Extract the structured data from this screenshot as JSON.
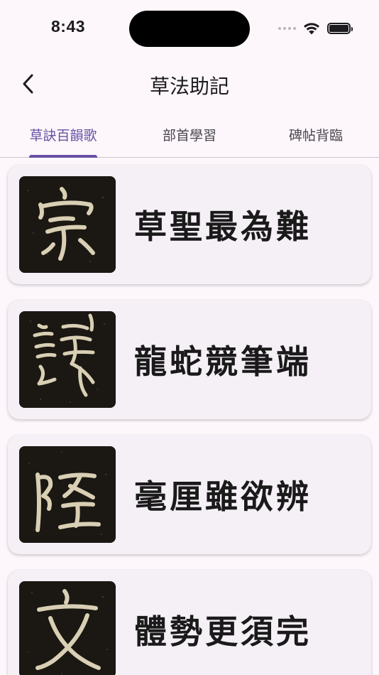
{
  "status_bar": {
    "time": "8:43"
  },
  "header": {
    "title": "草法助記",
    "back_icon": "chevron-left-icon"
  },
  "tabs": [
    {
      "label": "草訣百韻歌",
      "active": true
    },
    {
      "label": "部首學習",
      "active": false
    },
    {
      "label": "碑帖背臨",
      "active": false
    }
  ],
  "items": [
    {
      "text": "草聖最為難",
      "image_glyph": "宗"
    },
    {
      "text": "龍蛇競筆端",
      "image_glyph": "読"
    },
    {
      "text": "毫厘雖欲辨",
      "image_glyph": "陸"
    },
    {
      "text": "體勢更須完",
      "image_glyph": "文"
    }
  ],
  "colors": {
    "background": "#fdf7fb",
    "card": "#f5eff6",
    "accent": "#6750a4",
    "ink_paper": "#1b1712",
    "ink_stroke": "#d8cfb4"
  }
}
